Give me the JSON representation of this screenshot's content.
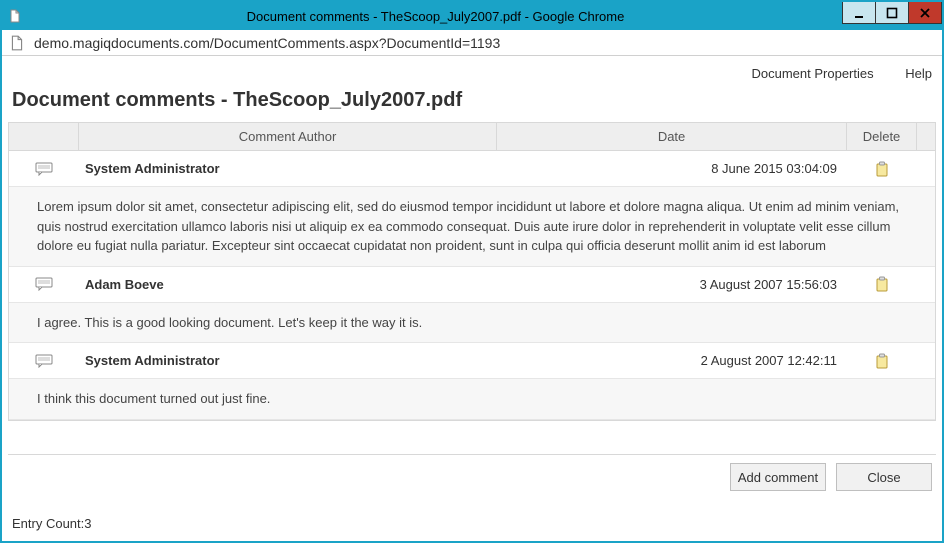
{
  "window": {
    "title": "Document comments - TheScoop_July2007.pdf - Google Chrome"
  },
  "address_bar": {
    "url": "demo.magiqdocuments.com/DocumentComments.aspx?DocumentId=1193"
  },
  "nav": {
    "doc_props": "Document Properties",
    "help": "Help"
  },
  "page": {
    "heading": "Document comments - TheScoop_July2007.pdf"
  },
  "headers": {
    "icon": "",
    "author": "Comment Author",
    "date": "Date",
    "delete": "Delete"
  },
  "comments": [
    {
      "author": "System Administrator",
      "date": "8 June 2015 03:04:09",
      "body": "Lorem ipsum dolor sit amet, consectetur adipiscing elit, sed do eiusmod tempor incididunt ut labore et dolore magna aliqua. Ut enim ad minim veniam, quis nostrud exercitation ullamco laboris nisi ut aliquip ex ea commodo consequat. Duis aute irure dolor in reprehenderit in voluptate velit esse cillum dolore eu fugiat nulla pariatur. Excepteur sint occaecat cupidatat non proident, sunt in culpa qui officia deserunt mollit anim id est laborum"
    },
    {
      "author": "Adam Boeve",
      "date": "3 August 2007 15:56:03",
      "body": "I agree. This is a good looking document. Let's keep it the way it is."
    },
    {
      "author": "System Administrator",
      "date": "2 August 2007 12:42:11",
      "body": "I think this document turned out just fine."
    }
  ],
  "buttons": {
    "add": "Add comment",
    "close": "Close"
  },
  "status": {
    "entry_count": "Entry Count:3"
  }
}
